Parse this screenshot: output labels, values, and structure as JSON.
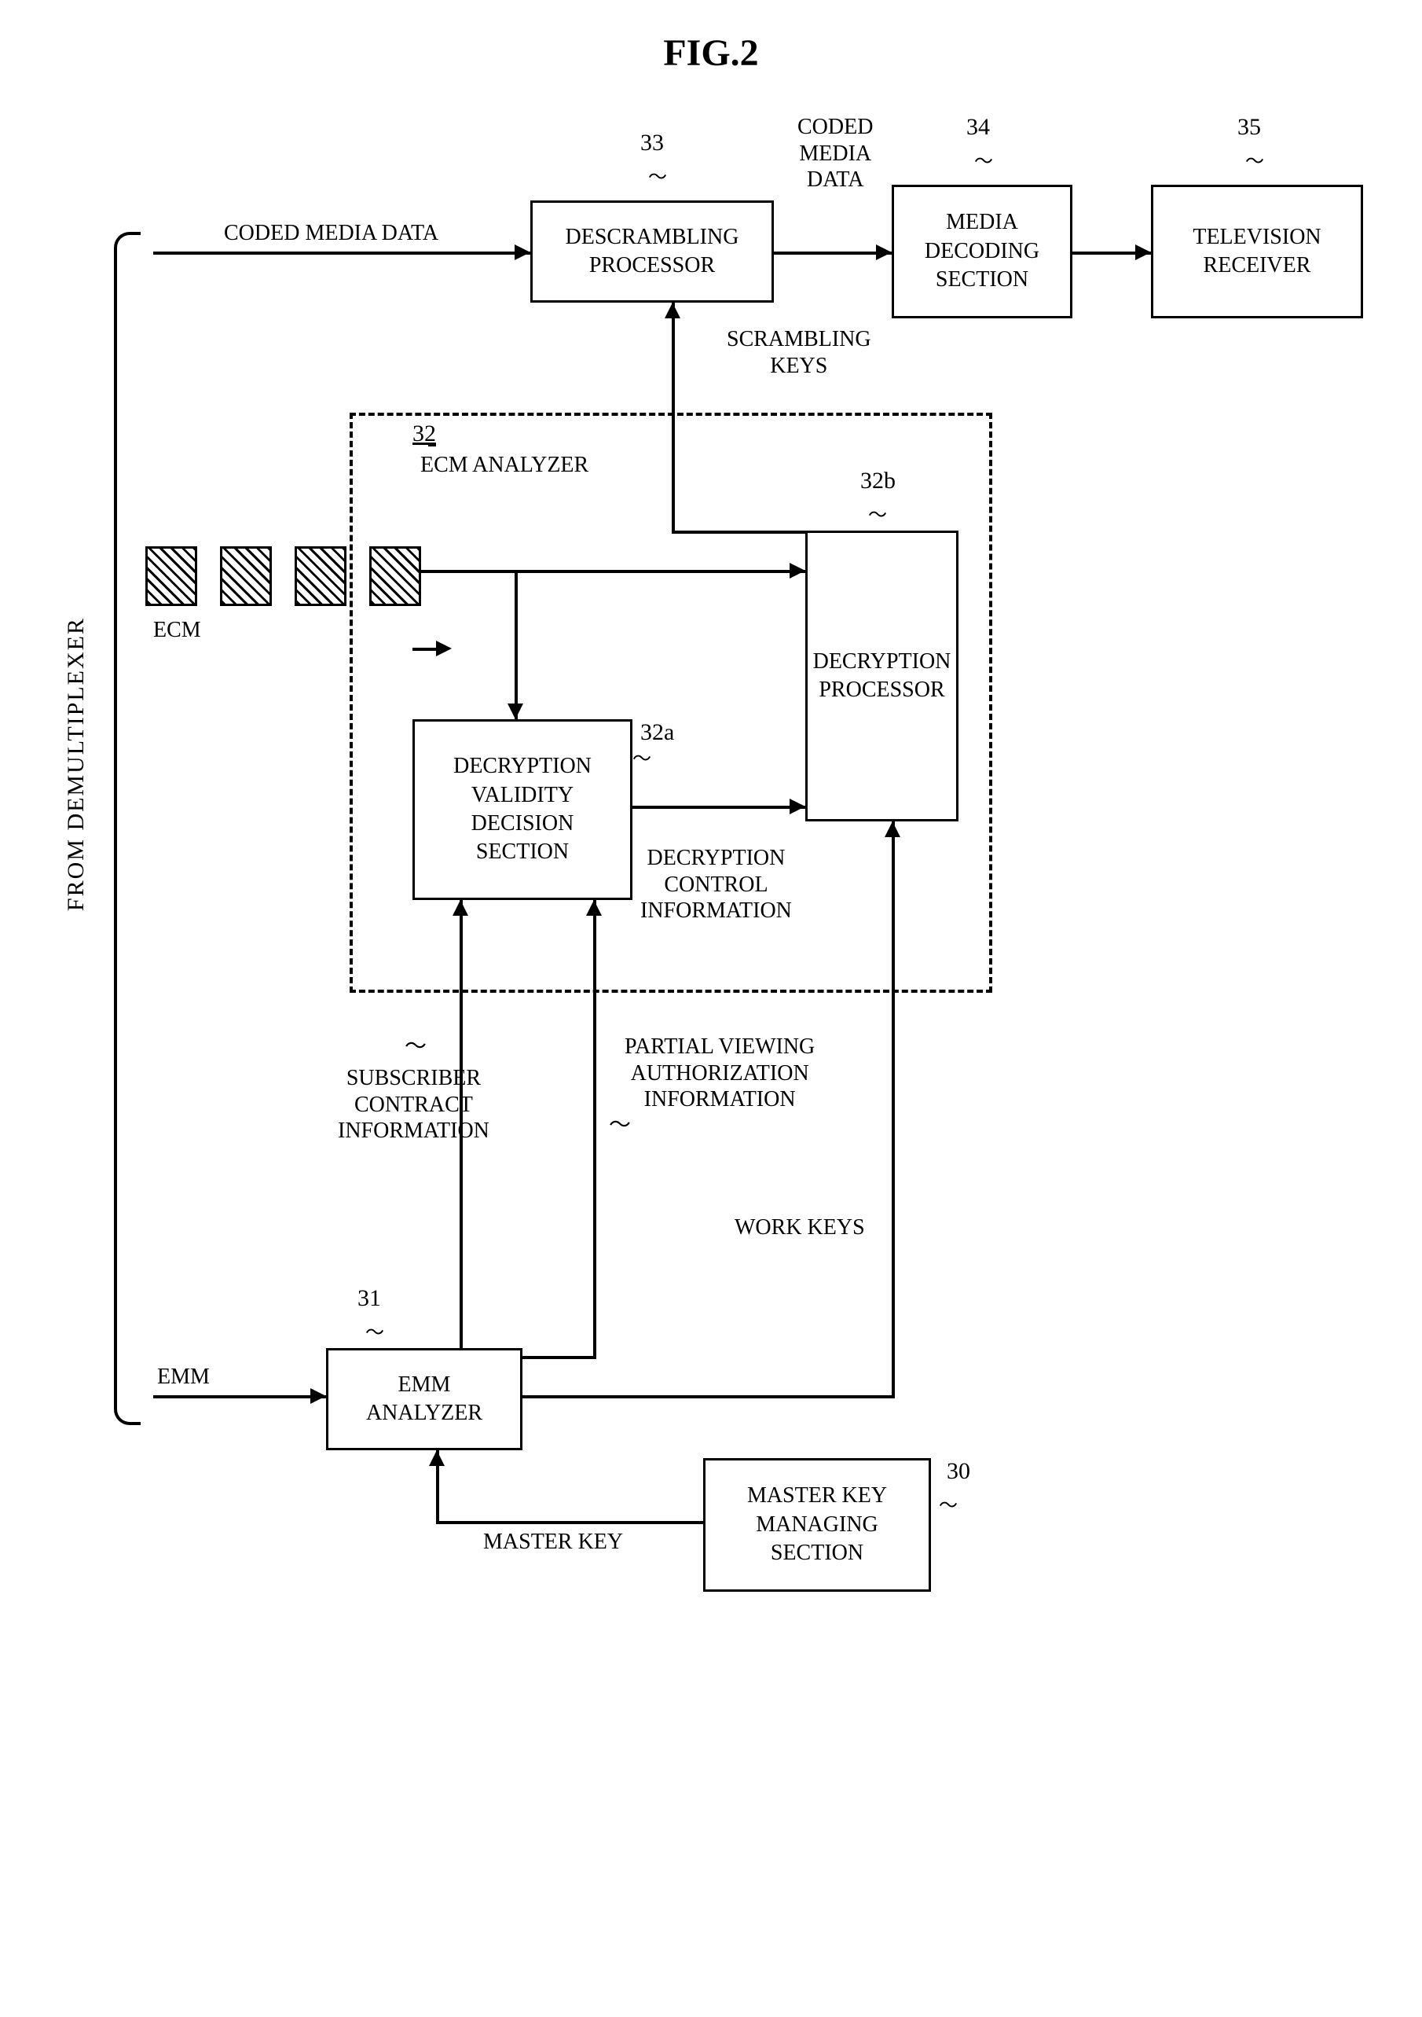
{
  "figure_title": "FIG.2",
  "boxes": {
    "descrambling": "DESCRAMBLING\nPROCESSOR",
    "media_decoding": "MEDIA\nDECODING\nSECTION",
    "television": "TELEVISION\nRECEIVER",
    "decryption_validity": "DECRYPTION\nVALIDITY\nDECISION\nSECTION",
    "decryption_processor": "DECRYPTION\nPROCESSOR",
    "emm_analyzer": "EMM\nANALYZER",
    "master_key": "MASTER KEY\nMANAGING\nSECTION"
  },
  "labels": {
    "coded_media_data_top": "CODED MEDIA DATA",
    "coded_media_data_right": "CODED\nMEDIA\nDATA",
    "scrambling_keys": "SCRAMBLING\nKEYS",
    "ecm_analyzer": "ECM ANALYZER",
    "ecm": "ECM",
    "decryption_control": "DECRYPTION\nCONTROL\nINFORMATION",
    "subscriber_contract": "SUBSCRIBER\nCONTRACT\nINFORMATION",
    "partial_viewing": "PARTIAL VIEWING\nAUTHORIZATION\nINFORMATION",
    "work_keys": "WORK KEYS",
    "emm": "EMM",
    "master_key_label": "MASTER KEY",
    "from_demux": "FROM DEMULTIPLEXER"
  },
  "refs": {
    "r33": "33",
    "r34": "34",
    "r35": "35",
    "r32": "32",
    "r32a": "32a",
    "r32b": "32b",
    "r31": "31",
    "r30": "30"
  }
}
